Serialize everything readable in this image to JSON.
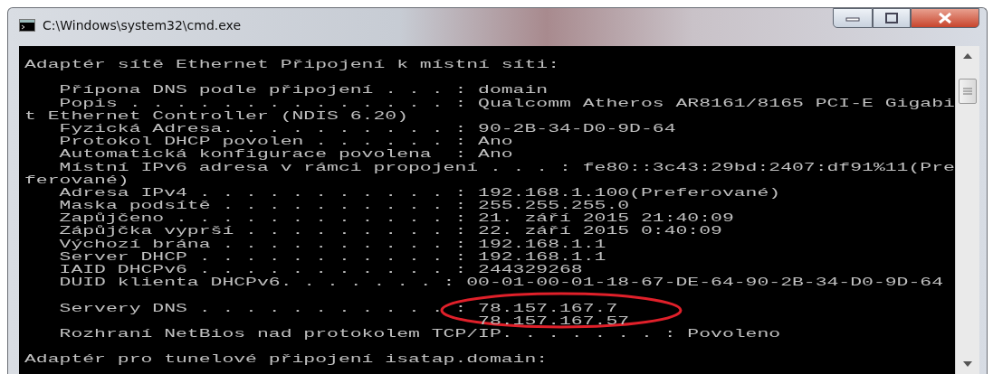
{
  "window": {
    "title": "C:\\Windows\\system32\\cmd.exe"
  },
  "console": {
    "lines": [
      {
        "kind": "text",
        "text": "Adaptér sítě Ethernet Připojení k místní síti:"
      },
      {
        "kind": "blank"
      },
      {
        "kind": "text",
        "text": "   Přípona DNS podle připojení . . . : domain"
      },
      {
        "kind": "text",
        "text": "   Popis . . . . . . . . . . . . . . : Qualcomm Atheros AR8161/8165 PCI-E Gigabi"
      },
      {
        "kind": "text",
        "text": "t Ethernet Controller (NDIS 6.20)"
      },
      {
        "kind": "text",
        "text": "   Fyzická Adresa. . . . . . . . . . : 90-2B-34-D0-9D-64"
      },
      {
        "kind": "text",
        "text": "   Protokol DHCP povolen . . . . . . : Ano"
      },
      {
        "kind": "text",
        "text": "   Automatická konfigurace povolena  : Ano"
      },
      {
        "kind": "text",
        "text": "   Místní IPv6 adresa v rámci propojení . . . : fe80::3c43:29bd:2407:df91%11(Pre"
      },
      {
        "kind": "text",
        "text": "ferované)"
      },
      {
        "kind": "text",
        "text": "   Adresa IPv4 . . . . . . . . . . . : 192.168.1.100(Preferované)"
      },
      {
        "kind": "text",
        "text": "   Maska podsítě . . . . . . . . . . : 255.255.255.0"
      },
      {
        "kind": "text",
        "text": "   Zapůjčeno . . . . . . . . . . . . : 21. září 2015 21:40:09"
      },
      {
        "kind": "text",
        "text": "   Zápůjčka vyprší . . . . . . . . . : 22. září 2015 0:40:09"
      },
      {
        "kind": "text",
        "text": "   Výchozí brána . . . . . . . . . . : 192.168.1.1"
      },
      {
        "kind": "text",
        "text": "   Server DHCP . . . . . . . . . . . : 192.168.1.1"
      },
      {
        "kind": "text",
        "text": "   IAID DHCPv6 . . . . . . . . . . . : 244329268"
      },
      {
        "kind": "text",
        "text": "   DUID klienta DHCPv6. . . . . . . : 00-01-00-01-18-67-DE-64-90-2B-34-D0-9D-64"
      },
      {
        "kind": "blank"
      },
      {
        "kind": "text",
        "text": "   Servery DNS . . . . . . . . . . . : 78.157.167.7"
      },
      {
        "kind": "text",
        "text": "                                       78.157.167.57"
      },
      {
        "kind": "text",
        "text": "   Rozhraní NetBios nad protokolem TCP/IP. . . . . . . : Povoleno"
      },
      {
        "kind": "blank"
      },
      {
        "kind": "text",
        "text": "Adaptér pro tunelové připojení isatap.domain:"
      }
    ]
  }
}
